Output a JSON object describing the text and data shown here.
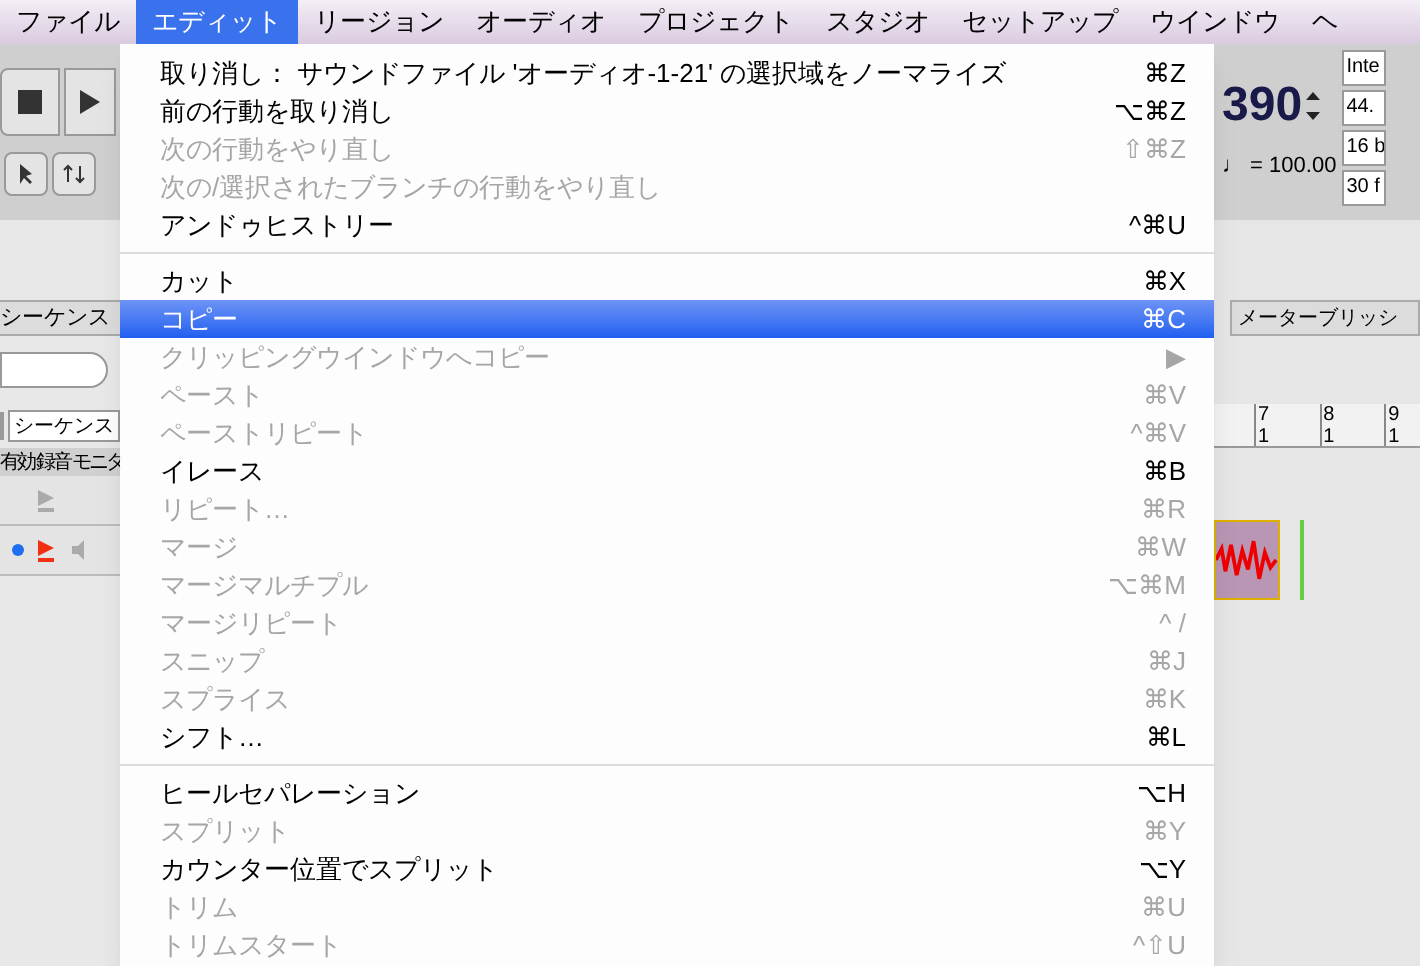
{
  "menu_bar": [
    {
      "label": "ファイル",
      "selected": false
    },
    {
      "label": "エディット",
      "selected": true
    },
    {
      "label": "リージョン",
      "selected": false
    },
    {
      "label": "オーディオ",
      "selected": false
    },
    {
      "label": "プロジェクト",
      "selected": false
    },
    {
      "label": "スタジオ",
      "selected": false
    },
    {
      "label": "セットアップ",
      "selected": false
    },
    {
      "label": "ウインドウ",
      "selected": false
    },
    {
      "label": "ヘ",
      "selected": false
    }
  ],
  "left_panel": {
    "tab": "シーケンス",
    "dropdown": "シーケンス",
    "columns": [
      "有効",
      "録音",
      "モニタ"
    ],
    "tracks": [
      {
        "active": false,
        "record": false
      },
      {
        "active": true,
        "record": true
      }
    ]
  },
  "right_panel": {
    "tempo_value": "390",
    "tempo": "♩ = 100.00",
    "settings": [
      "Inte",
      "44.",
      "16 b",
      "30 f"
    ],
    "tab": "メーターブリッシ",
    "ruler": [
      {
        "bar": "7",
        "beat": "1"
      },
      {
        "bar": "8",
        "beat": "1"
      },
      {
        "bar": "9",
        "beat": "1"
      }
    ]
  },
  "edit_menu": [
    {
      "kind": "item",
      "label": "取り消し： サウンドファイル 'オーディオ-1-21' の選択域をノーマライズ",
      "shortcut": "⌘Z",
      "disabled": false,
      "selected": false
    },
    {
      "kind": "item",
      "label": "前の行動を取り消し",
      "shortcut": "⌥⌘Z",
      "disabled": false,
      "selected": false
    },
    {
      "kind": "item",
      "label": "次の行動をやり直し",
      "shortcut": "⇧⌘Z",
      "disabled": true,
      "selected": false
    },
    {
      "kind": "item",
      "label": "次の/選択されたブランチの行動をやり直し",
      "disabled": true,
      "selected": false
    },
    {
      "kind": "item",
      "label": "アンドゥヒストリー",
      "shortcut": "^⌘U",
      "disabled": false,
      "selected": false
    },
    {
      "kind": "separator"
    },
    {
      "kind": "item",
      "label": "カット",
      "shortcut": "⌘X",
      "disabled": false,
      "selected": false
    },
    {
      "kind": "item",
      "label": "コピー",
      "shortcut": "⌘C",
      "disabled": false,
      "selected": true
    },
    {
      "kind": "item",
      "label": "クリッピングウインドウへコピー",
      "shortcut": "▶",
      "disabled": true,
      "selected": false
    },
    {
      "kind": "item",
      "label": "ペースト",
      "shortcut": "⌘V",
      "disabled": true,
      "selected": false
    },
    {
      "kind": "item",
      "label": "ペーストリピート",
      "shortcut": "^⌘V",
      "disabled": true,
      "selected": false
    },
    {
      "kind": "item",
      "label": "イレース",
      "shortcut": "⌘B",
      "disabled": false,
      "selected": false
    },
    {
      "kind": "item",
      "label": "リピート…",
      "shortcut": "⌘R",
      "disabled": true,
      "selected": false
    },
    {
      "kind": "item",
      "label": "マージ",
      "shortcut": "⌘W",
      "disabled": true,
      "selected": false
    },
    {
      "kind": "item",
      "label": "マージマルチプル",
      "shortcut": "⌥⌘M",
      "disabled": true,
      "selected": false
    },
    {
      "kind": "item",
      "label": "マージリピート",
      "shortcut": "^ /",
      "disabled": true,
      "selected": false
    },
    {
      "kind": "item",
      "label": "スニップ",
      "shortcut": "⌘J",
      "disabled": true,
      "selected": false
    },
    {
      "kind": "item",
      "label": "スプライス",
      "shortcut": "⌘K",
      "disabled": true,
      "selected": false
    },
    {
      "kind": "item",
      "label": "シフト…",
      "shortcut": "⌘L",
      "disabled": false,
      "selected": false
    },
    {
      "kind": "separator"
    },
    {
      "kind": "item",
      "label": "ヒールセパレーション",
      "shortcut": "⌥H",
      "disabled": false,
      "selected": false
    },
    {
      "kind": "item",
      "label": "スプリット",
      "shortcut": "⌘Y",
      "disabled": true,
      "selected": false
    },
    {
      "kind": "item",
      "label": "カウンター位置でスプリット",
      "shortcut": "⌥Y",
      "disabled": false,
      "selected": false
    },
    {
      "kind": "item",
      "label": "トリム",
      "shortcut": "⌘U",
      "disabled": true,
      "selected": false
    },
    {
      "kind": "item",
      "label": "トリムスタート",
      "shortcut": "^⇧U",
      "disabled": true,
      "selected": false
    }
  ]
}
